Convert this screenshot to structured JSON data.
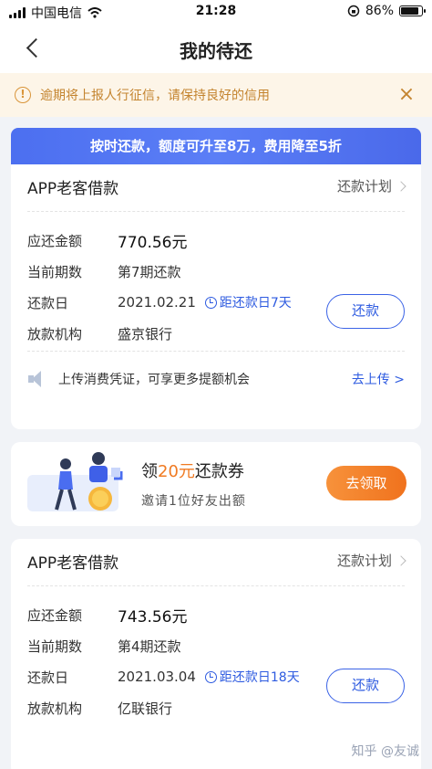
{
  "status_bar": {
    "carrier": "中国电信",
    "time": "21:28",
    "battery": "86%",
    "battery_level": 0.86
  },
  "nav": {
    "title": "我的待还"
  },
  "notice": {
    "text": "逾期将上报人行征信，请保持良好的信用",
    "icon": "warning-icon",
    "close_icon": "close-icon"
  },
  "promo": {
    "text": "按时还款，额度可升至8万，费用降至5折"
  },
  "loans": [
    {
      "title": "APP老客借款",
      "plan_label": "还款计划",
      "labels": {
        "amount": "应还金额",
        "period": "当前期数",
        "due_date": "还款日",
        "lender": "放款机构"
      },
      "amount": "770.56元",
      "period": "第7期还款",
      "due_date": "2021.02.21",
      "countdown": "距还款日7天",
      "lender": "盛京银行",
      "repay_label": "还款"
    },
    {
      "title": "APP老客借款",
      "plan_label": "还款计划",
      "labels": {
        "amount": "应还金额",
        "period": "当前期数",
        "due_date": "还款日",
        "lender": "放款机构"
      },
      "amount": "743.56元",
      "period": "第4期还款",
      "due_date": "2021.03.04",
      "countdown": "距还款日18天",
      "lender": "亿联银行",
      "repay_label": "还款"
    }
  ],
  "upload": {
    "text": "上传消费凭证，可享更多提额机会",
    "link": "去上传 >"
  },
  "coupon": {
    "prefix": "领",
    "highlight": "20元",
    "suffix": "还款券",
    "subtitle": "邀请1位好友出额",
    "button": "去领取"
  },
  "watermark": "知乎 @友诚",
  "colors": {
    "accent": "#2e5be0",
    "orange": "#f07a22",
    "warning": "#c4842f"
  }
}
